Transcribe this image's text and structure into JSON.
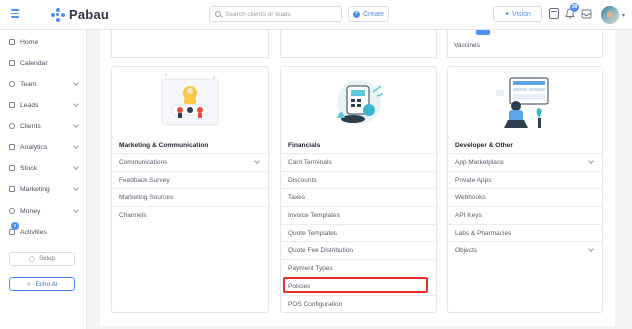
{
  "header": {
    "brand": "Pabau",
    "search_placeholder": "Search clients or leads",
    "create_label": "Create",
    "vision_label": "Vision",
    "notification_count": "38",
    "icons": [
      "menu-icon",
      "calendar-icon",
      "bell-icon",
      "inbox-icon",
      "avatar"
    ]
  },
  "sidebar": {
    "items": [
      {
        "label": "Home",
        "icon": "home-icon"
      },
      {
        "label": "Calendar",
        "icon": "calendar-icon"
      },
      {
        "label": "Team",
        "icon": "team-icon"
      },
      {
        "label": "Leads",
        "icon": "leads-icon"
      },
      {
        "label": "Clients",
        "icon": "clients-icon"
      },
      {
        "label": "Analytics",
        "icon": "analytics-icon"
      },
      {
        "label": "Stock",
        "icon": "stock-icon"
      },
      {
        "label": "Marketing",
        "icon": "marketing-icon"
      },
      {
        "label": "Money",
        "icon": "money-icon"
      },
      {
        "label": "Activities",
        "icon": "activities-icon"
      }
    ],
    "activities_badge": "6",
    "setup_label": "Setup",
    "echo_label": "Echo AI"
  },
  "top_right_card": {
    "item": "Vaccines"
  },
  "cards": [
    {
      "title": "Marketing & Communication",
      "items": [
        "Communications",
        "Feedback Survey",
        "Marketing Sources",
        "Channels"
      ]
    },
    {
      "title": "Financials",
      "items": [
        "Card Terminals",
        "Discounts",
        "Taxes",
        "Invoice Templates",
        "Quote Templates",
        "Quote Fee Distribution",
        "Payment Types",
        "Policies",
        "POS Configuration"
      ]
    },
    {
      "title": "Developer & Other",
      "items": [
        "App Marketplace",
        "Private Apps",
        "Webhooks",
        "API Keys",
        "Labs & Pharmacies",
        "Objects"
      ]
    }
  ],
  "highlighted_item": "Policies",
  "colors": {
    "accent": "#4b8ff7",
    "highlight": "#e3312f",
    "background": "#f3f4f6"
  }
}
